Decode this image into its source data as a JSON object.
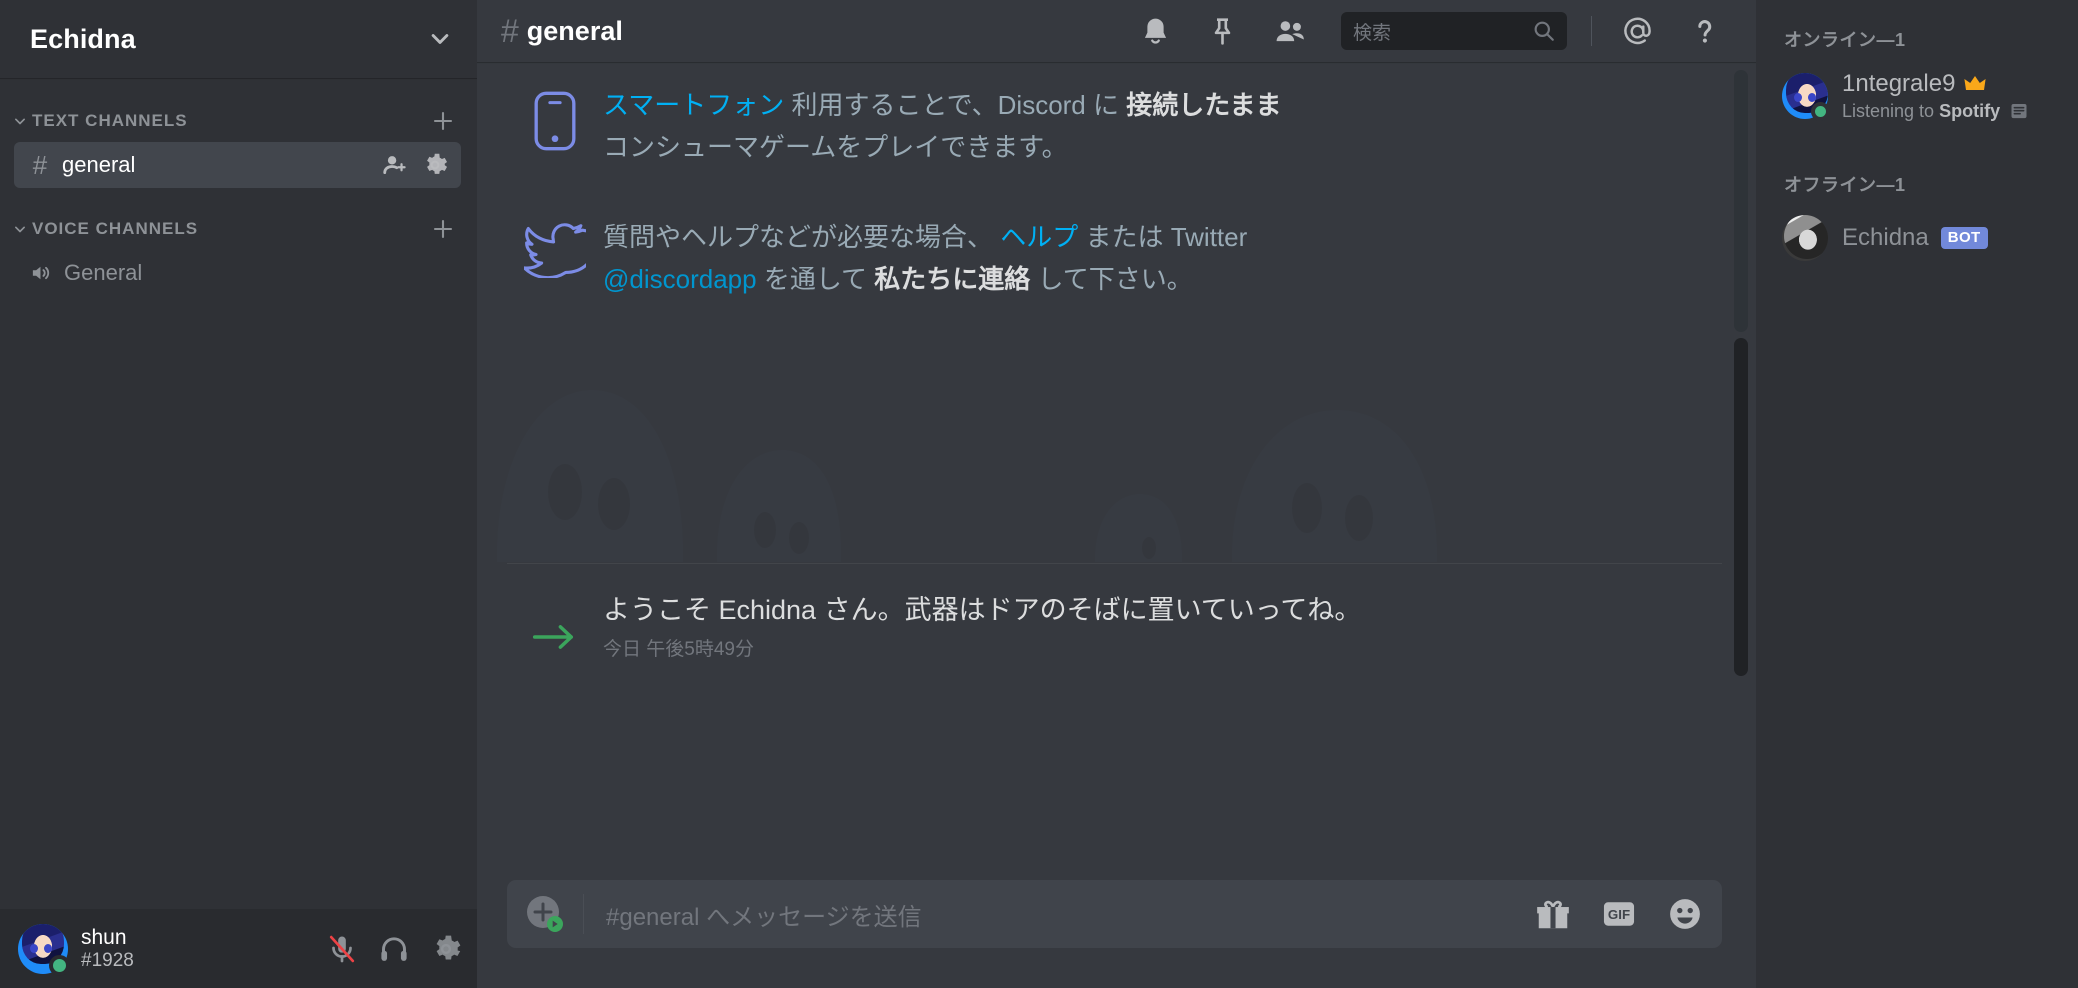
{
  "sidebar": {
    "guild_name": "Echidna",
    "categories": [
      {
        "label": "TEXT CHANNELS",
        "channels": [
          {
            "name": "general",
            "prefix": "#",
            "active": true
          }
        ]
      },
      {
        "label": "VOICE CHANNELS",
        "channels": [
          {
            "name": "General",
            "prefix": "speaker",
            "active": false
          }
        ]
      }
    ],
    "user_panel": {
      "name": "shun",
      "tag": "#1928",
      "status": "online",
      "mute_icon": "microphone-muted-icon",
      "deafen_icon": "headphones-icon",
      "settings_icon": "gear-icon"
    }
  },
  "topbar": {
    "hash": "#",
    "title": "general",
    "icons": [
      "bell-icon",
      "pin-icon",
      "members-icon"
    ],
    "search": {
      "placeholder": "検索",
      "value": ""
    },
    "mention_icon": "at-icon",
    "help_icon": "question-mark-icon"
  },
  "messages": [
    {
      "icon": "phone-icon",
      "segments": [
        {
          "text": "スマートフォン",
          "style": "link"
        },
        {
          "text": " 利用することで、Discord に ",
          "style": "normal"
        },
        {
          "text": "接続したまま",
          "style": "bold"
        },
        {
          "text": " コンシューマゲームをプレイできます。",
          "style": "normal"
        }
      ]
    },
    {
      "icon": "twitter-icon",
      "segments": [
        {
          "text": "質問やヘルプなどが必要な場合、 ",
          "style": "normal"
        },
        {
          "text": "ヘルプ",
          "style": "link"
        },
        {
          "text": " または Twitter ",
          "style": "normal"
        },
        {
          "text": "@discordapp",
          "style": "link2"
        },
        {
          "text": " を通して ",
          "style": "normal"
        },
        {
          "text": "私たちに連絡",
          "style": "bold"
        },
        {
          "text": " して下さい。",
          "style": "normal"
        }
      ]
    }
  ],
  "welcome": {
    "icon": "arrow-right-icon",
    "text": "ようこそ Echidna さん。武器はドアのそばに置いていってね。",
    "timestamp": "今日 午後5時49分"
  },
  "composer": {
    "placeholder": "#general へメッセージを送信",
    "value": "",
    "upload_icon": "plus-circle-icon",
    "gift_icon": "gift-icon",
    "gif_icon": "gif-icon",
    "gif_label": "GIF",
    "emoji_icon": "emoji-icon"
  },
  "members": {
    "groups": [
      {
        "header": "オンライン—1",
        "items": [
          {
            "name": "1ntegrale9",
            "status": "online",
            "owner": true,
            "owner_icon": "crown-icon",
            "activity_prefix": "Listening to",
            "activity_name": "Spotify",
            "activity_icon": "spotify-list-icon",
            "bot": false
          }
        ]
      },
      {
        "header": "オフライン—1",
        "items": [
          {
            "name": "Echidna",
            "status": "offline",
            "owner": false,
            "bot": true,
            "bot_label": "BOT"
          }
        ]
      }
    ]
  },
  "colors": {
    "sidebar_bg": "#2f3136",
    "main_bg": "#36393f",
    "user_panel_bg": "#292b2f",
    "accent_blurple": "#7289da",
    "link_blue": "#00b0f4",
    "online_green": "#43b581",
    "arrow_green": "#3ba55c",
    "crown_gold": "#faa81a",
    "active_channel_bg": "#42464d"
  }
}
